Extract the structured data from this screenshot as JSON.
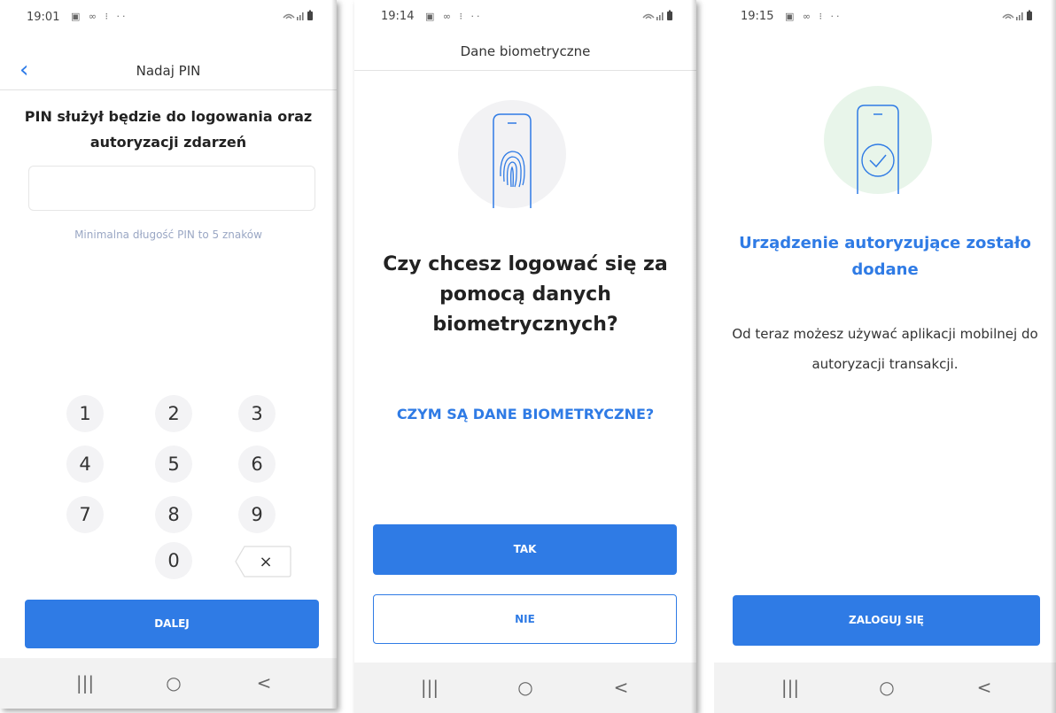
{
  "colors": {
    "accent": "#2f7be5",
    "keypad_bg": "#f3f3f5",
    "fingerprint_circle": "#f2f2f4",
    "success_circle": "#e8f5ea"
  },
  "screen1": {
    "status": {
      "time": "19:01",
      "left_icons": "▣ ∞ ⁝ ··",
      "right_icons": "WiFi ▮"
    },
    "header": {
      "title": "Nadaj PIN",
      "back_icon": "chevron-left"
    },
    "heading": "PIN służył będzie do logowania oraz autoryzacji zdarzeń",
    "pin_field": {
      "value": "",
      "placeholder": ""
    },
    "hint": "Minimalna długość PIN to 5 znaków",
    "keys": [
      "1",
      "2",
      "3",
      "4",
      "5",
      "6",
      "7",
      "8",
      "9",
      "0"
    ],
    "backspace": "×",
    "button": "DALEJ",
    "nav": {
      "recent": "|||",
      "home": "○",
      "back": "<"
    }
  },
  "screen2": {
    "status": {
      "time": "19:14",
      "left_icons": "▣ ∞ ⁝ ··",
      "right_icons": "WiFi ▮"
    },
    "header": {
      "title": "Dane biometryczne"
    },
    "question": "Czy chcesz logować się za pomocą danych biometrycznych?",
    "link": "CZYM SĄ DANE BIOMETRYCZNE?",
    "yes_button": "TAK",
    "no_button": "NIE",
    "nav": {
      "recent": "|||",
      "home": "○",
      "back": "<"
    }
  },
  "screen3": {
    "status": {
      "time": "19:15",
      "left_icons": "▣ ∞ ⁝ ··",
      "right_icons": "WiFi ▮"
    },
    "title": "Urządzenie autoryzujące zostało dodane",
    "text": "Od teraz możesz używać aplikacji mobilnej do autoryzacji transakcji.",
    "button": "ZALOGUJ SIĘ",
    "nav": {
      "recent": "|||",
      "home": "○",
      "back": "<"
    }
  }
}
